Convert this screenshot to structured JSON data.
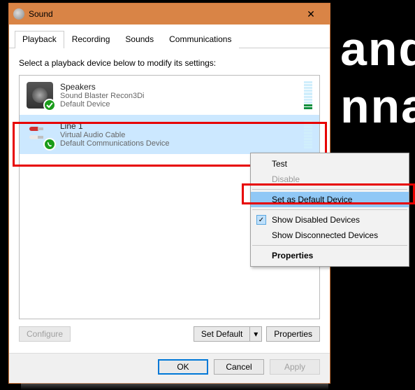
{
  "background_text": [
    "and",
    "nna"
  ],
  "window": {
    "title": "Sound",
    "close": "✕",
    "tabs": [
      "Playback",
      "Recording",
      "Sounds",
      "Communications"
    ],
    "active_tab": 0,
    "instruction": "Select a playback device below to modify its settings:",
    "devices": [
      {
        "name": "Speakers",
        "sub": "Sound Blaster Recon3Di",
        "status": "Default Device",
        "selected": false
      },
      {
        "name": "Line 1",
        "sub": "Virtual Audio Cable",
        "status": "Default Communications Device",
        "selected": true
      }
    ],
    "buttons": {
      "configure": "Configure",
      "set_default": "Set Default",
      "properties": "Properties",
      "ok": "OK",
      "cancel": "Cancel",
      "apply": "Apply"
    }
  },
  "context_menu": {
    "test": "Test",
    "disable": "Disable",
    "set_default": "Set as Default Device",
    "show_disabled": "Show Disabled Devices",
    "show_disconnected": "Show Disconnected Devices",
    "properties": "Properties"
  }
}
